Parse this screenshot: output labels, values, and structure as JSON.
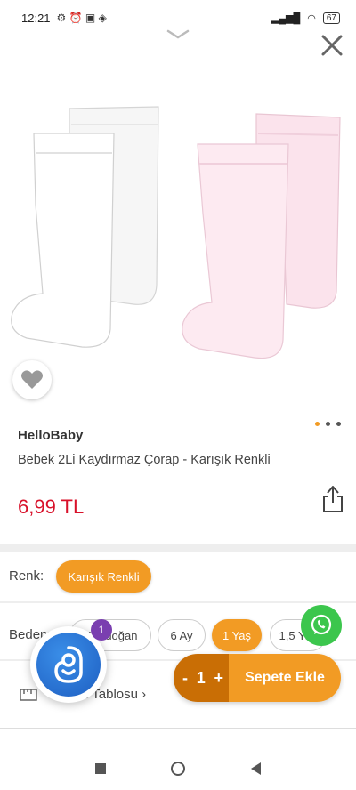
{
  "status_bar": {
    "time": "12:21",
    "battery": "67"
  },
  "product": {
    "brand": "HelloBaby",
    "name": "Bebek 2Li Kaydırmaz Çorap - Karışık Renkli",
    "price": "6,99 TL",
    "image_count": 3,
    "active_image_index": 0
  },
  "color_option": {
    "label": "Renk:",
    "selected": "Karışık Renkli"
  },
  "size_option": {
    "label": "Beden:",
    "options": [
      "Yenidoğan",
      "6 Ay",
      "1 Yaş",
      "1,5 Yaş"
    ],
    "selected": "1 Yaş"
  },
  "size_table": {
    "label": "Beden Tablosu ›"
  },
  "notification_count": "1",
  "cart": {
    "minus": "-",
    "quantity": "1",
    "plus": "+",
    "add_label": "Sepete Ekle"
  },
  "colors": {
    "accent": "#f29b24",
    "accent_dark": "#c96e05",
    "price": "#d8112a",
    "whatsapp": "#3cc64d"
  },
  "icons": [
    "chevron-down-icon",
    "close-icon",
    "heart-icon",
    "share-icon",
    "whatsapp-icon",
    "ruler-icon"
  ]
}
